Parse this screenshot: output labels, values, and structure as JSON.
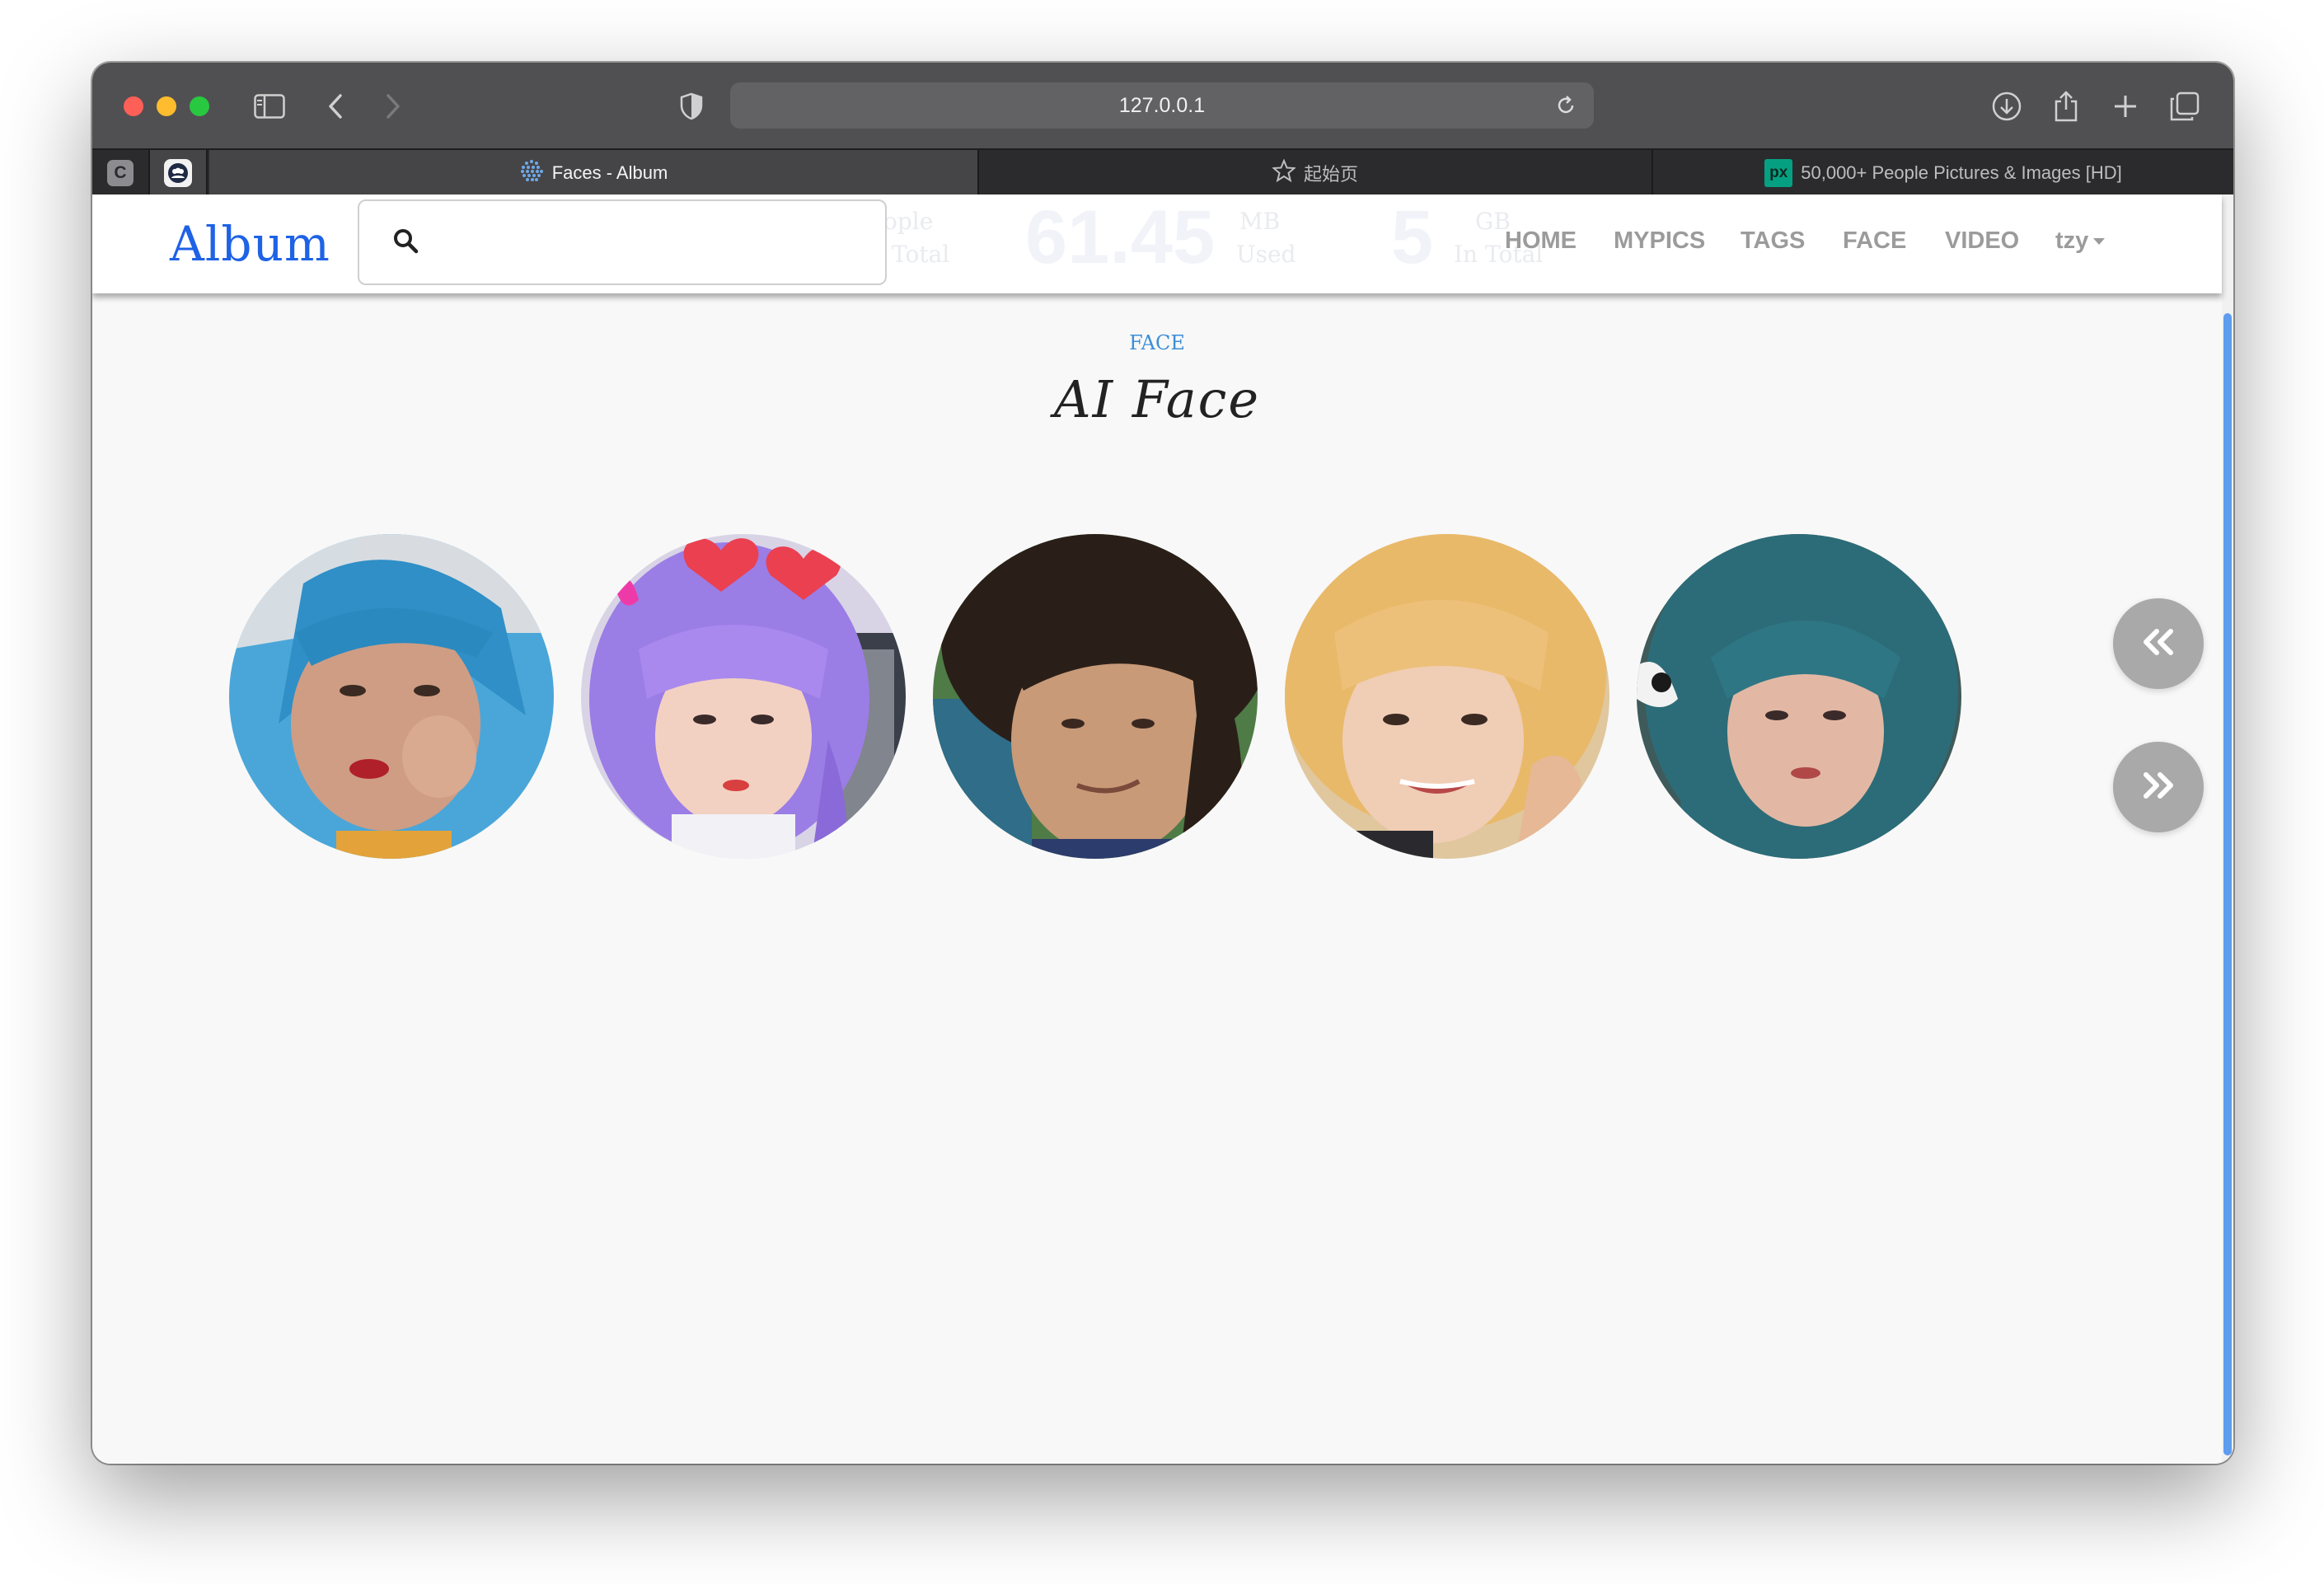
{
  "browser": {
    "url": "127.0.0.1",
    "tabs": [
      {
        "label": "Faces - Album",
        "active": true
      },
      {
        "label": "起始页",
        "active": false
      },
      {
        "label": "50,000+ People Pictures & Images [HD]",
        "active": false
      }
    ],
    "pinned": [
      {
        "label": "C"
      }
    ],
    "tab_icon_px": "px"
  },
  "site": {
    "brand": "Album",
    "search": {
      "value": "",
      "placeholder": ""
    },
    "nav": [
      "HOME",
      "MYPICS",
      "TAGS",
      "FACE",
      "VIDEO"
    ],
    "user": "tzy",
    "stats_ghost": [
      "ople",
      "Total",
      "61.45",
      "MB",
      "Used",
      "5",
      "GB",
      "In Total"
    ]
  },
  "section": {
    "tag": "FACE",
    "title": "AI Face"
  },
  "faces": [
    {
      "label": "face-1"
    },
    {
      "label": "face-2"
    },
    {
      "label": "face-3"
    },
    {
      "label": "face-4"
    },
    {
      "label": "face-5"
    }
  ],
  "controls": {
    "prev_icon": "double-chevron-left-icon",
    "next_icon": "double-chevron-right-icon"
  },
  "colors": {
    "brand": "#1e62e6",
    "section_tag": "#3c8ed6",
    "scroll_thumb": "#5e9cf0",
    "fab": "#a9a9a9"
  }
}
